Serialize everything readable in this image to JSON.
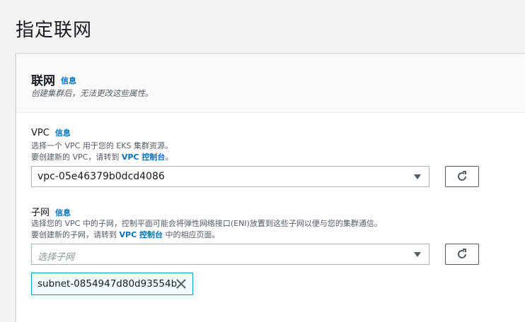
{
  "page": {
    "title": "指定联网"
  },
  "panel": {
    "title": "联网",
    "info": "信息",
    "description": "创建集群后，无法更改这些属性。"
  },
  "vpc": {
    "label": "VPC",
    "info": "信息",
    "desc_line1": "选择一个 VPC 用于您的 EKS 集群资源。",
    "desc_line2_prefix": "要创建新的 VPC，请转到 ",
    "console_link": "VPC 控制台",
    "desc_line2_suffix": "。",
    "selected_value": "vpc-05e46379b0dcd4086",
    "caret_icon": "caret-down-icon",
    "refresh_icon": "refresh-icon"
  },
  "subnets": {
    "label": "子网",
    "info": "信息",
    "desc_line1": "选择您的 VPC 中的子网，控制平面可能会将弹性网络接口(ENI)放置到这些子网以便与您的集群通信。",
    "desc_line2_prefix": "要创建新的子网，请转到 ",
    "console_link": "VPC 控制台",
    "desc_line2_suffix": " 中的相应页面。",
    "placeholder": "选择子网",
    "caret_icon": "caret-down-icon",
    "refresh_icon": "refresh-icon",
    "selected_tokens": [
      "subnet-0854947d80d93554b"
    ],
    "remove_icon": "close-icon"
  },
  "colors": {
    "background": "#f2f3f3",
    "link": "#0073bb",
    "token_border": "#00a1c9",
    "token_bg": "#f1faff"
  }
}
